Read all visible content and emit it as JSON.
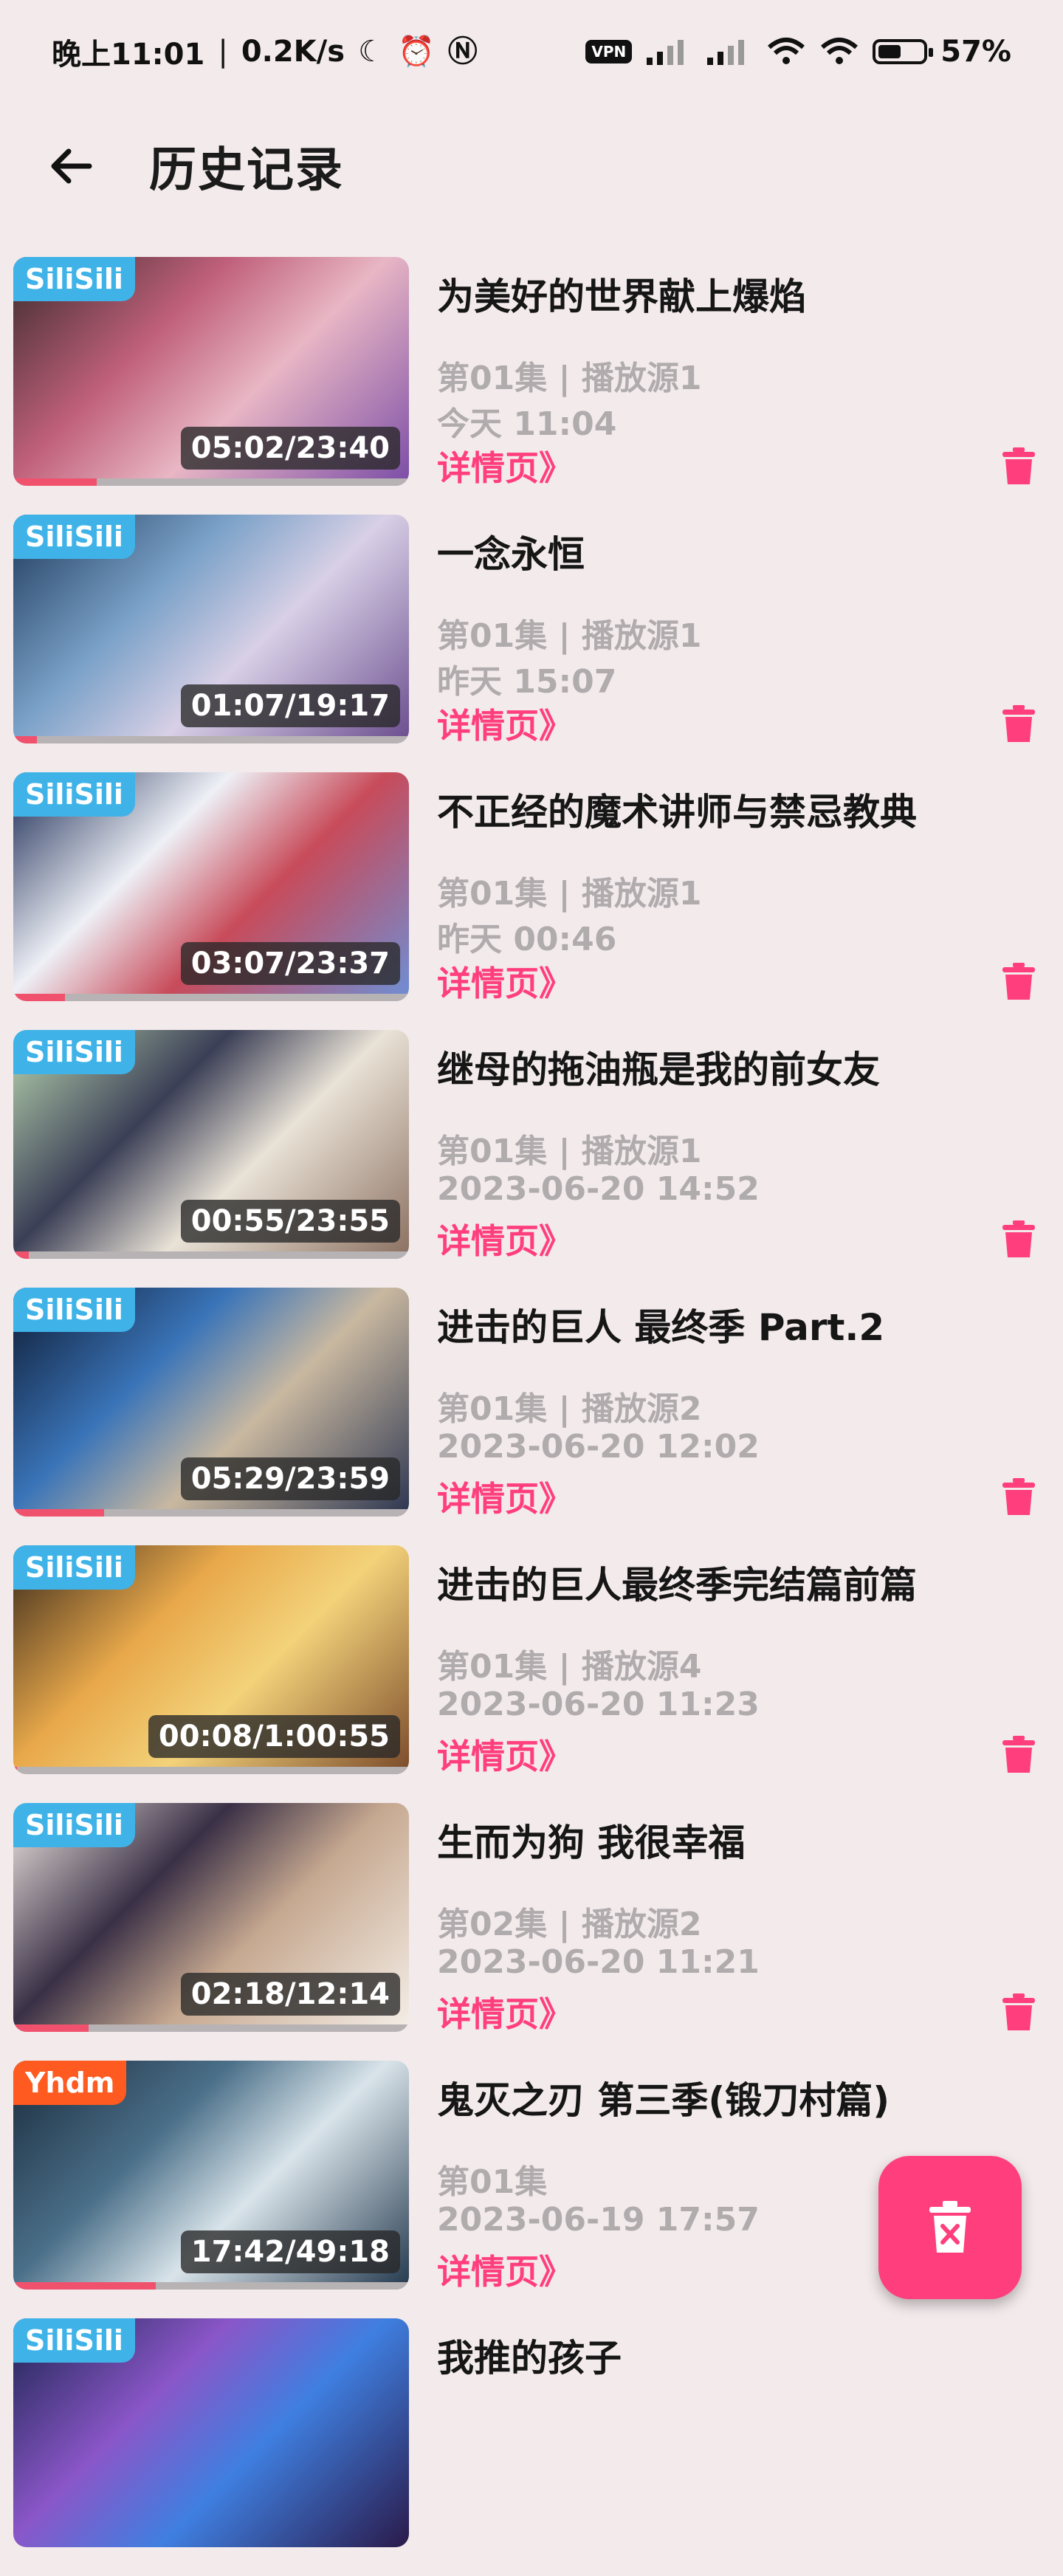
{
  "status_bar": {
    "time": "晚上11:01",
    "speed": "0.2K/s",
    "vpn": "VPN",
    "battery": "57%"
  },
  "header": {
    "title": "历史记录"
  },
  "colors": {
    "accent": "#ff3f7d",
    "silisili_badge": "#3fb3e8",
    "yhdm_badge": "#ff5a1f",
    "progress": "#f0526d"
  },
  "detail_label": "详情页》",
  "items": [
    {
      "source": "SiliSili",
      "title": "为美好的世界献上爆焰",
      "episode": "第01集 | 播放源1",
      "watched": "今天 11:04",
      "time": "05:02/23:40",
      "progress": 0.21,
      "art": [
        "#3b2b2d",
        "#c0607a",
        "#e8b6c4",
        "#7a4ca6"
      ]
    },
    {
      "source": "SiliSili",
      "title": "一念永恒",
      "episode": "第01集 | 播放源1",
      "watched": "昨天 15:07",
      "time": "01:07/19:17",
      "progress": 0.06,
      "art": [
        "#1f3a5c",
        "#7aa1c8",
        "#d8d0e6",
        "#6a4c8e"
      ]
    },
    {
      "source": "SiliSili",
      "title": "不正经的魔术讲师与禁忌教典",
      "episode": "第01集 | 播放源1",
      "watched": "昨天 00:46",
      "time": "03:07/23:37",
      "progress": 0.13,
      "art": [
        "#1a2a54",
        "#eef0f6",
        "#c84b5a",
        "#6d8fd6"
      ]
    },
    {
      "source": "SiliSili",
      "title": "继母的拖油瓶是我的前女友",
      "episode": "第01集 | 播放源1",
      "watched": "2023-06-20 14:52",
      "time": "00:55/23:55",
      "progress": 0.04,
      "art": [
        "#b9d6b0",
        "#3b3f56",
        "#e9e2d6",
        "#8a6f60"
      ]
    },
    {
      "source": "SiliSili",
      "title": "进击的巨人 最终季 Part.2",
      "episode": "第01集 | 播放源2",
      "watched": "2023-06-20 12:02",
      "time": "05:29/23:59",
      "progress": 0.23,
      "art": [
        "#0e1b33",
        "#3a74b8",
        "#c9b8a0",
        "#2b3550"
      ]
    },
    {
      "source": "SiliSili",
      "title": "进击的巨人最终季完结篇前篇",
      "episode": "第01集 | 播放源4",
      "watched": "2023-06-20 11:23",
      "time": "00:08/1:00:55",
      "progress": 0.01,
      "art": [
        "#3a2a1c",
        "#e8a84a",
        "#f3d27a",
        "#7a4a2a"
      ]
    },
    {
      "source": "SiliSili",
      "title": "生而为狗 我很幸福",
      "episode": "第02集 | 播放源2",
      "watched": "2023-06-20 11:21",
      "time": "02:18/12:14",
      "progress": 0.19,
      "art": [
        "#efe7e2",
        "#3a3046",
        "#c6a890",
        "#f5efe8"
      ]
    },
    {
      "source": "Yhdm",
      "title": "鬼灭之刃 第三季(锻刀村篇)",
      "episode": "第01集",
      "watched": "2023-06-19 17:57",
      "time": "17:42/49:18",
      "progress": 0.36,
      "art": [
        "#1b2c3e",
        "#4a6f88",
        "#d9e4ea",
        "#23384d"
      ]
    },
    {
      "source": "SiliSili",
      "title": "我推的孩子",
      "episode": "",
      "watched": "",
      "time": "",
      "progress": 0,
      "art": [
        "#1b2550",
        "#8a56c8",
        "#3f7fe0",
        "#2a1a4a"
      ]
    }
  ]
}
